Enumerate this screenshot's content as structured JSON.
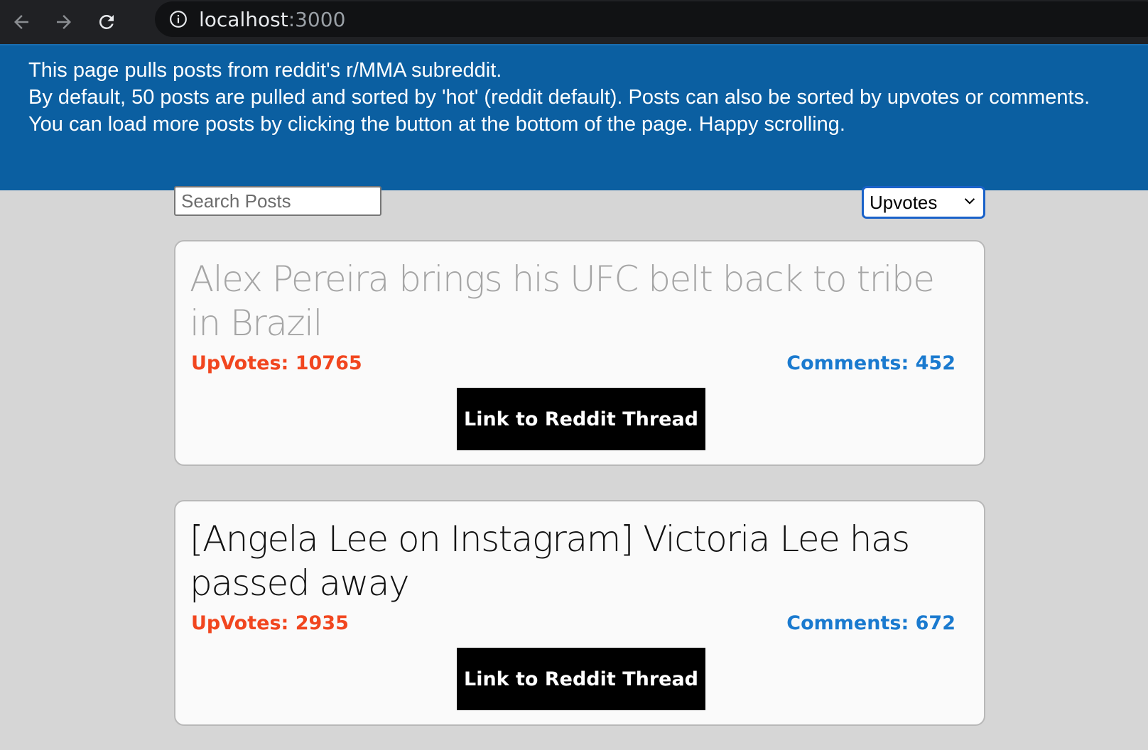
{
  "browser": {
    "url_host": "localhost",
    "url_port": ":3000"
  },
  "banner": {
    "line1": "This page pulls posts from reddit's r/MMA subreddit.",
    "line2": "By default, 50 posts are pulled and sorted by 'hot' (reddit default). Posts can also be sorted by upvotes or comments. You can load more posts by clicking the button at the bottom of the page. Happy scrolling."
  },
  "controls": {
    "search_placeholder": "Search Posts",
    "sort_selected": "Upvotes"
  },
  "posts": [
    {
      "title": "Alex Pereira brings his UFC belt back to tribe in Brazil",
      "upvotes": "UpVotes: 10765",
      "comments": "Comments: 452",
      "link_label": "Link to Reddit Thread"
    },
    {
      "title": "[Angela Lee on Instagram] Victoria Lee has passed away",
      "upvotes": "UpVotes: 2935",
      "comments": "Comments: 672",
      "link_label": "Link to Reddit Thread"
    }
  ],
  "colors": {
    "banner_bg": "#0b5fa1",
    "upvotes": "#f1461f",
    "comments": "#1a7acf",
    "page_bg": "#d6d6d6"
  }
}
